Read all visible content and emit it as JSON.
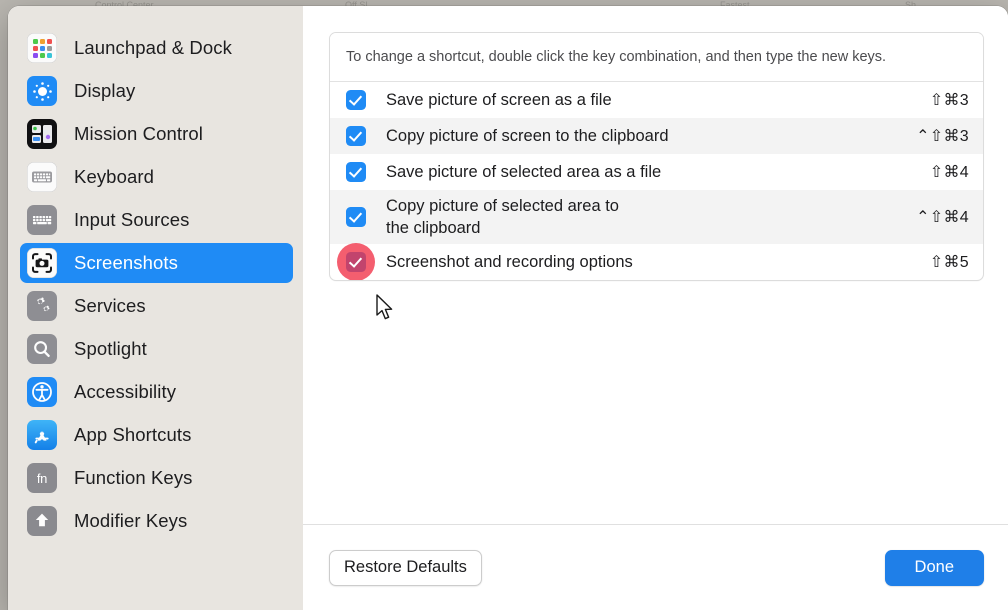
{
  "background_strips": [
    "Control Center",
    "Off  Sl",
    "",
    "Fastest",
    "Sh"
  ],
  "sidebar": {
    "items": [
      {
        "label": "Launchpad & Dock",
        "icon": "launchpad-icon",
        "selected": false
      },
      {
        "label": "Display",
        "icon": "display-brightness-icon",
        "selected": false
      },
      {
        "label": "Mission Control",
        "icon": "mission-control-icon",
        "selected": false
      },
      {
        "label": "Keyboard",
        "icon": "keyboard-icon",
        "selected": false
      },
      {
        "label": "Input Sources",
        "icon": "input-sources-keyboard-icon",
        "selected": false
      },
      {
        "label": "Screenshots",
        "icon": "screenshot-camera-icon",
        "selected": true
      },
      {
        "label": "Services",
        "icon": "services-gears-icon",
        "selected": false
      },
      {
        "label": "Spotlight",
        "icon": "spotlight-search-icon",
        "selected": false
      },
      {
        "label": "Accessibility",
        "icon": "accessibility-icon",
        "selected": false
      },
      {
        "label": "App Shortcuts",
        "icon": "app-store-icon",
        "selected": false
      },
      {
        "label": "Function Keys",
        "icon": "fn-key-icon",
        "selected": false
      },
      {
        "label": "Modifier Keys",
        "icon": "shift-arrow-icon",
        "selected": false
      }
    ]
  },
  "main": {
    "note": "To change a shortcut, double click the key combination, and then type the new keys.",
    "shortcuts": [
      {
        "checked": true,
        "label": "Save picture of screen as a file",
        "keys": "⇧⌘3"
      },
      {
        "checked": true,
        "label": "Copy picture of screen to the clipboard",
        "keys": "⌃⇧⌘3"
      },
      {
        "checked": true,
        "label": "Save picture of selected area as a file",
        "keys": "⇧⌘4"
      },
      {
        "checked": true,
        "label": "Copy picture of selected area to\nthe clipboard",
        "keys": "⌃⇧⌘4"
      },
      {
        "checked": true,
        "label": "Screenshot and recording options",
        "keys": "⇧⌘5"
      }
    ]
  },
  "footer": {
    "restore_label": "Restore Defaults",
    "done_label": "Done"
  },
  "colors": {
    "accent_blue": "#1f8bf5",
    "done_blue": "#1f7fe8",
    "sidebar_bg": "#e8e5e0",
    "row_alt_bg": "#f3f3f3",
    "click_highlight": "#f13146"
  }
}
